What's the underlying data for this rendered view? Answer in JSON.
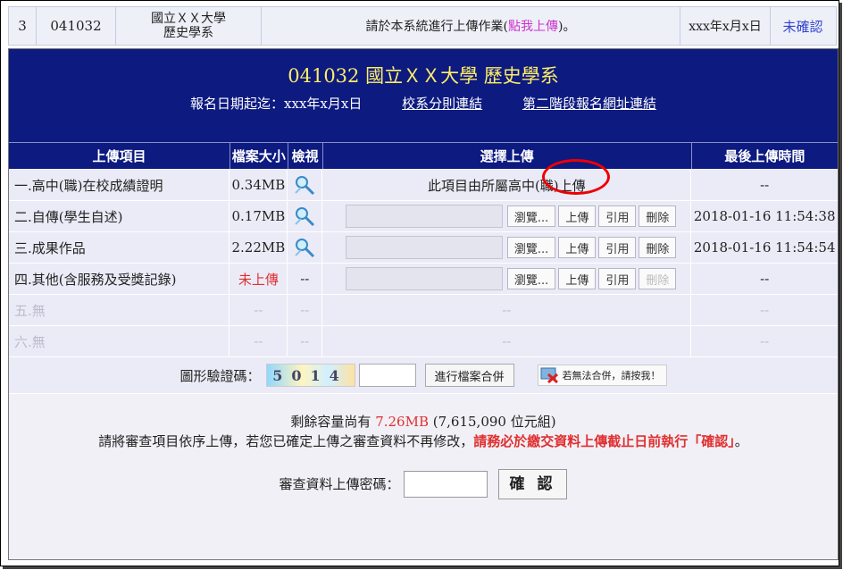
{
  "top": {
    "no": "3",
    "code": "041032",
    "school_line1": "國立ＸＸ大學",
    "school_line2": "歷史學系",
    "msg_pre": "請於本系統進行上傳作業(",
    "msg_link": "點我上傳",
    "msg_post": ")。",
    "date": "xxx年x月x日",
    "confirm": "未確認"
  },
  "header": {
    "title": "041032 國立ＸＸ大學 歷史學系",
    "deadline": "報名日期起迄：xxx年x月x日",
    "link1": "校系分則連結",
    "link2": "第二階段報名網址連結"
  },
  "columns": [
    "上傳項目",
    "檔案大小",
    "檢視",
    "選擇上傳",
    "最後上傳時間"
  ],
  "rows": [
    {
      "item": "一.高中(職)在校成績證明",
      "size": "0.34MB",
      "note": "此項目由所屬高中(職)上傳",
      "time": "--"
    },
    {
      "item": "二.自傳(學生自述)",
      "size": "0.17MB",
      "browse": "瀏覽...",
      "upload": "上傳",
      "cite": "引用",
      "del": "刪除",
      "time": "2018-01-16 11:54:38"
    },
    {
      "item": "三.成果作品",
      "size": "2.22MB",
      "browse": "瀏覽...",
      "upload": "上傳",
      "cite": "引用",
      "del": "刪除",
      "time": "2018-01-16 11:54:54"
    },
    {
      "item": "四.其他(含服務及受獎記錄)",
      "size": "未上傳",
      "view": "--",
      "browse": "瀏覽...",
      "upload": "上傳",
      "cite": "引用",
      "del": "刪除",
      "time": "--"
    },
    {
      "item": "五.無",
      "size": "--",
      "view": "--",
      "note": "--",
      "time": "--"
    },
    {
      "item": "六.無",
      "size": "--",
      "view": "--",
      "note": "--",
      "time": "--"
    }
  ],
  "captcha": {
    "label": "圖形驗證碼：",
    "code": "5014",
    "merge": "進行檔案合併",
    "help": "若無法合併，請按我！"
  },
  "footer": {
    "remain_pre": "剩餘容量尚有 ",
    "remain_val": "7.26MB",
    "remain_post": " (7,615,090 位元組)",
    "notice": "請將審查項目依序上傳，若您已確定上傳之審查資料不再修改，",
    "notice_red": "請務必於繳交資料上傳截止日前執行「確認」",
    "notice_end": "。",
    "pw_label": "審查資料上傳密碼：",
    "confirm_btn": "確 認"
  },
  "colors": {
    "header_bg": "#0d1a80",
    "title": "#ffee66",
    "accent_red": "#e03030"
  }
}
